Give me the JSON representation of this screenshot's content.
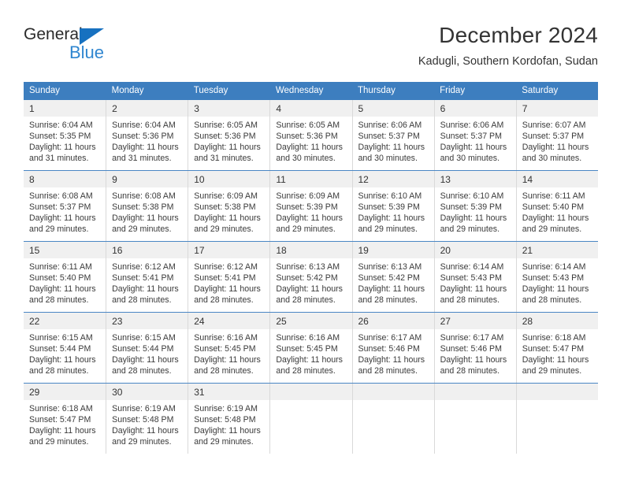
{
  "logo": {
    "word1": "General",
    "word2": "Blue",
    "triangle_color": "#1771c0",
    "word2_color": "#2f86d0"
  },
  "header": {
    "title": "December 2024",
    "subtitle": "Kadugli, Southern Kordofan, Sudan"
  },
  "theme": {
    "header_bg": "#3d7ebf",
    "header_text": "#ffffff",
    "daynum_bg": "#f0f0f0",
    "row_divider": "#4a86c4",
    "cell_divider": "#d9d9d9"
  },
  "weekdays": [
    "Sunday",
    "Monday",
    "Tuesday",
    "Wednesday",
    "Thursday",
    "Friday",
    "Saturday"
  ],
  "weeks": [
    [
      {
        "day": "1",
        "sunrise": "Sunrise: 6:04 AM",
        "sunset": "Sunset: 5:35 PM",
        "daylight1": "Daylight: 11 hours",
        "daylight2": "and 31 minutes."
      },
      {
        "day": "2",
        "sunrise": "Sunrise: 6:04 AM",
        "sunset": "Sunset: 5:36 PM",
        "daylight1": "Daylight: 11 hours",
        "daylight2": "and 31 minutes."
      },
      {
        "day": "3",
        "sunrise": "Sunrise: 6:05 AM",
        "sunset": "Sunset: 5:36 PM",
        "daylight1": "Daylight: 11 hours",
        "daylight2": "and 31 minutes."
      },
      {
        "day": "4",
        "sunrise": "Sunrise: 6:05 AM",
        "sunset": "Sunset: 5:36 PM",
        "daylight1": "Daylight: 11 hours",
        "daylight2": "and 30 minutes."
      },
      {
        "day": "5",
        "sunrise": "Sunrise: 6:06 AM",
        "sunset": "Sunset: 5:37 PM",
        "daylight1": "Daylight: 11 hours",
        "daylight2": "and 30 minutes."
      },
      {
        "day": "6",
        "sunrise": "Sunrise: 6:06 AM",
        "sunset": "Sunset: 5:37 PM",
        "daylight1": "Daylight: 11 hours",
        "daylight2": "and 30 minutes."
      },
      {
        "day": "7",
        "sunrise": "Sunrise: 6:07 AM",
        "sunset": "Sunset: 5:37 PM",
        "daylight1": "Daylight: 11 hours",
        "daylight2": "and 30 minutes."
      }
    ],
    [
      {
        "day": "8",
        "sunrise": "Sunrise: 6:08 AM",
        "sunset": "Sunset: 5:37 PM",
        "daylight1": "Daylight: 11 hours",
        "daylight2": "and 29 minutes."
      },
      {
        "day": "9",
        "sunrise": "Sunrise: 6:08 AM",
        "sunset": "Sunset: 5:38 PM",
        "daylight1": "Daylight: 11 hours",
        "daylight2": "and 29 minutes."
      },
      {
        "day": "10",
        "sunrise": "Sunrise: 6:09 AM",
        "sunset": "Sunset: 5:38 PM",
        "daylight1": "Daylight: 11 hours",
        "daylight2": "and 29 minutes."
      },
      {
        "day": "11",
        "sunrise": "Sunrise: 6:09 AM",
        "sunset": "Sunset: 5:39 PM",
        "daylight1": "Daylight: 11 hours",
        "daylight2": "and 29 minutes."
      },
      {
        "day": "12",
        "sunrise": "Sunrise: 6:10 AM",
        "sunset": "Sunset: 5:39 PM",
        "daylight1": "Daylight: 11 hours",
        "daylight2": "and 29 minutes."
      },
      {
        "day": "13",
        "sunrise": "Sunrise: 6:10 AM",
        "sunset": "Sunset: 5:39 PM",
        "daylight1": "Daylight: 11 hours",
        "daylight2": "and 29 minutes."
      },
      {
        "day": "14",
        "sunrise": "Sunrise: 6:11 AM",
        "sunset": "Sunset: 5:40 PM",
        "daylight1": "Daylight: 11 hours",
        "daylight2": "and 29 minutes."
      }
    ],
    [
      {
        "day": "15",
        "sunrise": "Sunrise: 6:11 AM",
        "sunset": "Sunset: 5:40 PM",
        "daylight1": "Daylight: 11 hours",
        "daylight2": "and 28 minutes."
      },
      {
        "day": "16",
        "sunrise": "Sunrise: 6:12 AM",
        "sunset": "Sunset: 5:41 PM",
        "daylight1": "Daylight: 11 hours",
        "daylight2": "and 28 minutes."
      },
      {
        "day": "17",
        "sunrise": "Sunrise: 6:12 AM",
        "sunset": "Sunset: 5:41 PM",
        "daylight1": "Daylight: 11 hours",
        "daylight2": "and 28 minutes."
      },
      {
        "day": "18",
        "sunrise": "Sunrise: 6:13 AM",
        "sunset": "Sunset: 5:42 PM",
        "daylight1": "Daylight: 11 hours",
        "daylight2": "and 28 minutes."
      },
      {
        "day": "19",
        "sunrise": "Sunrise: 6:13 AM",
        "sunset": "Sunset: 5:42 PM",
        "daylight1": "Daylight: 11 hours",
        "daylight2": "and 28 minutes."
      },
      {
        "day": "20",
        "sunrise": "Sunrise: 6:14 AM",
        "sunset": "Sunset: 5:43 PM",
        "daylight1": "Daylight: 11 hours",
        "daylight2": "and 28 minutes."
      },
      {
        "day": "21",
        "sunrise": "Sunrise: 6:14 AM",
        "sunset": "Sunset: 5:43 PM",
        "daylight1": "Daylight: 11 hours",
        "daylight2": "and 28 minutes."
      }
    ],
    [
      {
        "day": "22",
        "sunrise": "Sunrise: 6:15 AM",
        "sunset": "Sunset: 5:44 PM",
        "daylight1": "Daylight: 11 hours",
        "daylight2": "and 28 minutes."
      },
      {
        "day": "23",
        "sunrise": "Sunrise: 6:15 AM",
        "sunset": "Sunset: 5:44 PM",
        "daylight1": "Daylight: 11 hours",
        "daylight2": "and 28 minutes."
      },
      {
        "day": "24",
        "sunrise": "Sunrise: 6:16 AM",
        "sunset": "Sunset: 5:45 PM",
        "daylight1": "Daylight: 11 hours",
        "daylight2": "and 28 minutes."
      },
      {
        "day": "25",
        "sunrise": "Sunrise: 6:16 AM",
        "sunset": "Sunset: 5:45 PM",
        "daylight1": "Daylight: 11 hours",
        "daylight2": "and 28 minutes."
      },
      {
        "day": "26",
        "sunrise": "Sunrise: 6:17 AM",
        "sunset": "Sunset: 5:46 PM",
        "daylight1": "Daylight: 11 hours",
        "daylight2": "and 28 minutes."
      },
      {
        "day": "27",
        "sunrise": "Sunrise: 6:17 AM",
        "sunset": "Sunset: 5:46 PM",
        "daylight1": "Daylight: 11 hours",
        "daylight2": "and 28 minutes."
      },
      {
        "day": "28",
        "sunrise": "Sunrise: 6:18 AM",
        "sunset": "Sunset: 5:47 PM",
        "daylight1": "Daylight: 11 hours",
        "daylight2": "and 29 minutes."
      }
    ],
    [
      {
        "day": "29",
        "sunrise": "Sunrise: 6:18 AM",
        "sunset": "Sunset: 5:47 PM",
        "daylight1": "Daylight: 11 hours",
        "daylight2": "and 29 minutes."
      },
      {
        "day": "30",
        "sunrise": "Sunrise: 6:19 AM",
        "sunset": "Sunset: 5:48 PM",
        "daylight1": "Daylight: 11 hours",
        "daylight2": "and 29 minutes."
      },
      {
        "day": "31",
        "sunrise": "Sunrise: 6:19 AM",
        "sunset": "Sunset: 5:48 PM",
        "daylight1": "Daylight: 11 hours",
        "daylight2": "and 29 minutes."
      },
      {
        "day": "",
        "sunrise": "",
        "sunset": "",
        "daylight1": "",
        "daylight2": ""
      },
      {
        "day": "",
        "sunrise": "",
        "sunset": "",
        "daylight1": "",
        "daylight2": ""
      },
      {
        "day": "",
        "sunrise": "",
        "sunset": "",
        "daylight1": "",
        "daylight2": ""
      },
      {
        "day": "",
        "sunrise": "",
        "sunset": "",
        "daylight1": "",
        "daylight2": ""
      }
    ]
  ]
}
